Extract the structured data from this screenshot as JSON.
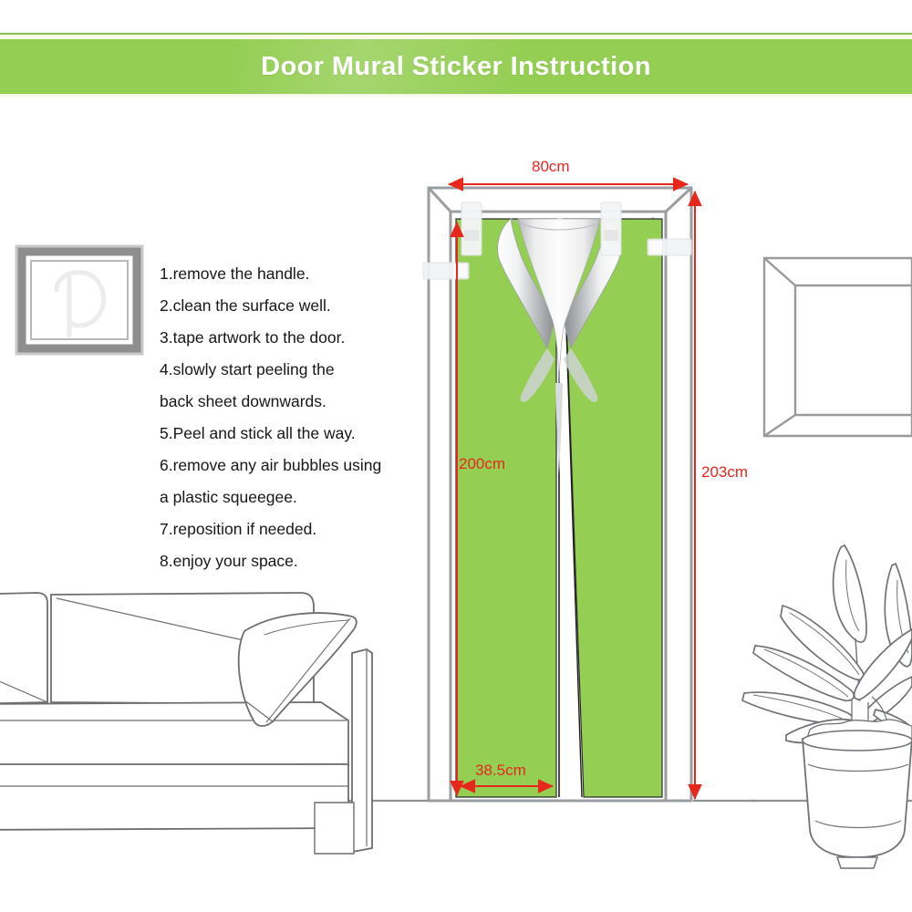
{
  "header": {
    "title": "Door Mural Sticker Instruction",
    "background_color": "#94ce53",
    "text_color": "#ffffff"
  },
  "instructions": {
    "steps": [
      "1.remove the handle.",
      "2.clean the surface well.",
      "3.tape artwork to the door.",
      "4.slowly start peeling the",
      "back sheet downwards.",
      "5.Peel and stick all the way.",
      "6.remove any air bubbles using",
      "a plastic squeegee.",
      "7.reposition if needed.",
      "8.enjoy your space."
    ]
  },
  "diagram": {
    "dimensions": {
      "sticker_width": "80cm",
      "sticker_height": "200cm",
      "door_height": "203cm",
      "panel_width": "38.5cm"
    },
    "colors": {
      "sticker_green": "#94ce53",
      "dimension_red": "#e8271c",
      "outline_gray": "#8a8a8a",
      "frame_gray": "#9b9ea0"
    },
    "scene_objects": [
      "wall-picture-frame-left",
      "wall-picture-frame-right",
      "sofa",
      "sofa-pillow",
      "potted-plant",
      "door-frame",
      "green-mural-sticker",
      "peeling-backing-sheet",
      "tape-strips",
      "floor-line"
    ]
  }
}
